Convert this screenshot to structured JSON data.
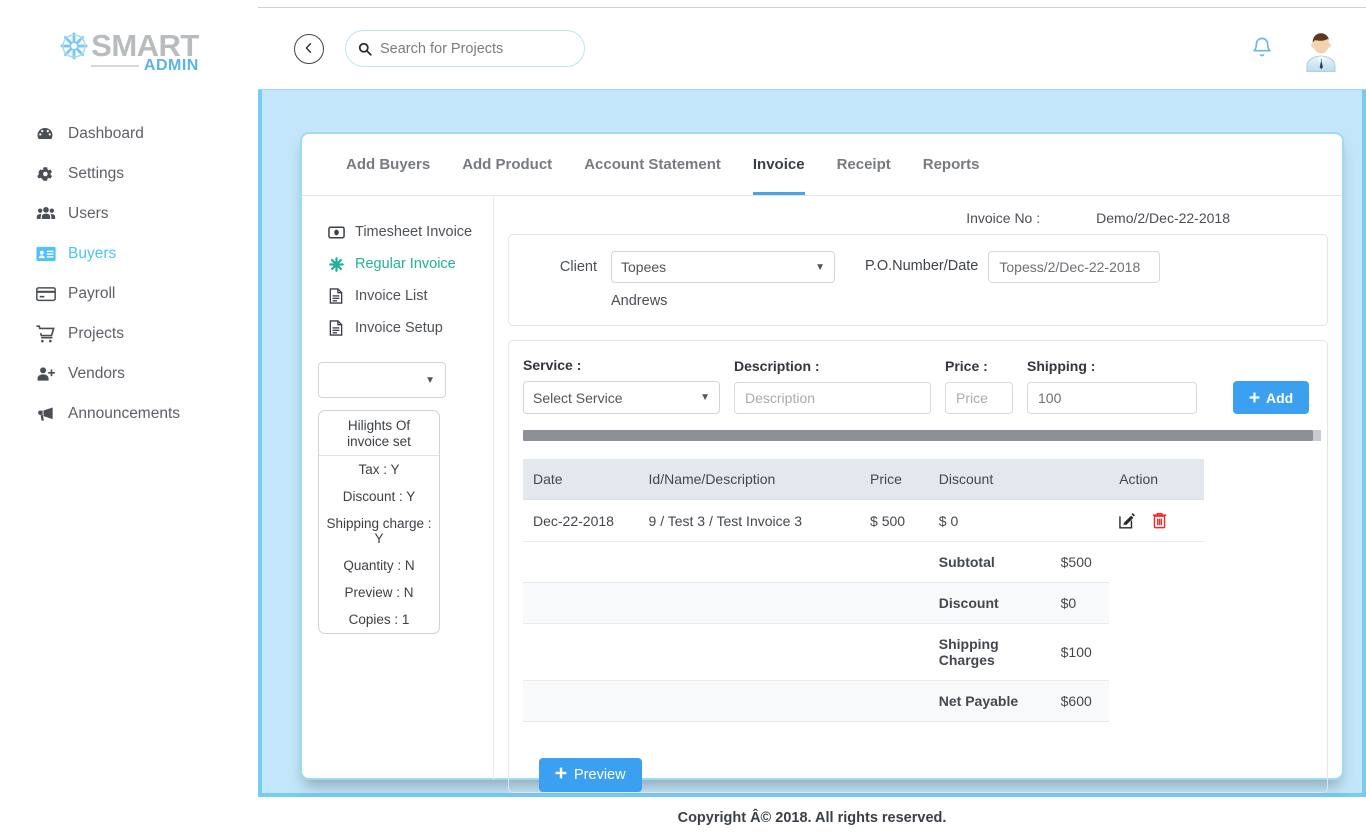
{
  "brand": {
    "name": "SMART",
    "sub": "ADMIN",
    "accent": "#5bb4e8",
    "mark_icon": "asterisk-flower-icon"
  },
  "sidebar": {
    "items": [
      {
        "label": "Dashboard",
        "icon": "dashboard-icon",
        "active": false
      },
      {
        "label": "Settings",
        "icon": "gear-icon",
        "active": false
      },
      {
        "label": "Users",
        "icon": "users-icon",
        "active": false
      },
      {
        "label": "Buyers",
        "icon": "id-card-icon",
        "active": true
      },
      {
        "label": "Payroll",
        "icon": "credit-card-icon",
        "active": false
      },
      {
        "label": "Projects",
        "icon": "shopping-cart-icon",
        "active": false
      },
      {
        "label": "Vendors",
        "icon": "user-plus-icon",
        "active": false
      },
      {
        "label": "Announcements",
        "icon": "megaphone-icon",
        "active": false
      }
    ]
  },
  "topbar": {
    "collapse_icon": "chevron-left-circle-icon",
    "search": {
      "placeholder": "Search for Projects",
      "value": "",
      "icon": "search-icon"
    },
    "bell_icon": "bell-icon",
    "avatar": "user-avatar"
  },
  "tabs": [
    {
      "label": "Add Buyers",
      "active": false
    },
    {
      "label": "Add Product",
      "active": false
    },
    {
      "label": "Account Statement",
      "active": false
    },
    {
      "label": "Invoice",
      "active": true
    },
    {
      "label": "Receipt",
      "active": false
    },
    {
      "label": "Reports",
      "active": false
    }
  ],
  "inner_nav": {
    "items": [
      {
        "label": "Timesheet Invoice",
        "icon": "money-bill-icon",
        "active": false
      },
      {
        "label": "Regular Invoice",
        "icon": "asterisk-icon",
        "active": true
      },
      {
        "label": "Invoice List",
        "icon": "file-text-icon",
        "active": false
      },
      {
        "label": "Invoice Setup",
        "icon": "file-text-icon",
        "active": false
      }
    ],
    "select": {
      "value": "",
      "caret_icon": "caret-down-icon"
    },
    "highlights": {
      "title": "Hilights Of invoice set",
      "rows": [
        "Tax : Y",
        "Discount : Y",
        "Shipping charge : Y",
        "Quantity : N",
        "Preview : N",
        "Copies : 1"
      ]
    }
  },
  "invoice": {
    "invoice_no_label": "Invoice No :",
    "invoice_no_value": "Demo/2/Dec-22-2018",
    "client_label": "Client",
    "client_value": "Topees",
    "client_sub": "Andrews",
    "po_label": "P.O.Number/Date",
    "po_value": "Topess/2/Dec-22-2018",
    "entry": {
      "service_label": "Service :",
      "service_value": "Select Service",
      "description_label": "Description :",
      "description_placeholder": "Description",
      "description_value": "",
      "price_label": "Price :",
      "price_placeholder": "Price",
      "price_value": "",
      "shipping_label": "Shipping :",
      "shipping_value": "100",
      "add_button": "Add",
      "add_icon": "plus-icon"
    },
    "table": {
      "columns": [
        "Date",
        "Id/Name/Description",
        "Price",
        "Discount",
        "",
        "Action"
      ],
      "rows": [
        {
          "date": "Dec-22-2018",
          "description": "9 / Test 3 /  Test Invoice 3",
          "price": "$ 500",
          "discount": "$ 0",
          "edit_icon": "edit-pencil-icon",
          "delete_icon": "trash-icon"
        }
      ],
      "totals": [
        {
          "label": "Subtotal",
          "value": "$500"
        },
        {
          "label": "Discount",
          "value": "$0"
        },
        {
          "label": "Shipping Charges",
          "value": "$100"
        },
        {
          "label": "Net Payable",
          "value": "$600"
        }
      ]
    },
    "preview_button": "Preview",
    "preview_icon": "plus-icon"
  },
  "footer": {
    "text": "Copyright Â© 2018. All rights reserved."
  },
  "colors": {
    "canvas_bg": "#c3e6fa",
    "canvas_border": "#77ccf2",
    "primary_button": "#3ca0f0",
    "active_nav": "#4fc3f7",
    "active_inner_nav": "#21b293",
    "table_header": "#e2e8ee",
    "danger": "#ef2b2b"
  }
}
